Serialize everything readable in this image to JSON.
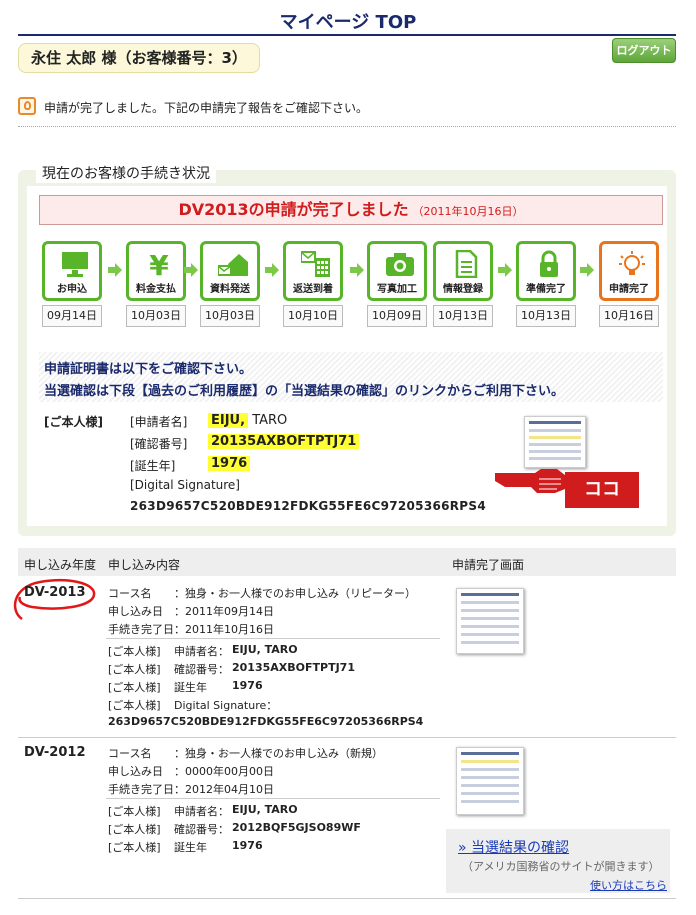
{
  "header": {
    "title": "マイページ TOP",
    "customer": "永住 太郎 様（お客様番号：3）",
    "logout": "ログアウト"
  },
  "message": "申請が完了しました。下記の申請完了報告をご確認下さい。",
  "status": {
    "title": "現在のお客様の手続き状況",
    "banner_main": "DV2013の申請が完了しました",
    "banner_date": "（2011年10月16日）",
    "steps": [
      {
        "label": "お申込",
        "date": "09月14日",
        "icon": "monitor-icon"
      },
      {
        "label": "料金支払",
        "date": "10月03日",
        "icon": "yen-icon"
      },
      {
        "label": "資料発送",
        "date": "10月03日",
        "icon": "house-mail-icon"
      },
      {
        "label": "返送到着",
        "date": "10月10日",
        "icon": "mail-keypad-icon"
      },
      {
        "label": "写真加工",
        "date": "10月09日",
        "icon": "camera-icon"
      },
      {
        "label": "情報登録",
        "date": "10月13日",
        "icon": "document-icon"
      },
      {
        "label": "準備完了",
        "date": "10月13日",
        "icon": "lock-icon"
      },
      {
        "label": "申請完了",
        "date": "10月16日",
        "icon": "lightbulb-icon"
      }
    ],
    "note1": "申請証明書は以下をご確認下さい。",
    "note2": "当選確認は下段【過去のご利用履歴】の「当選結果の確認」のリンクからご利用下さい。",
    "owner_label": "[ご本人様]",
    "name_label": "[申請者名]",
    "name_hl": "EIJU,",
    "name_rest": " TARO",
    "confirm_label": "[確認番号]",
    "confirm": "20135AXBOFTPTJ71",
    "birth_label": "[誕生年]",
    "birth": "1976",
    "sig_label": "[Digital Signature]",
    "sig": "263D9657C520BDE912FDKG55FE6C97205366RPS4",
    "koko": "ココ"
  },
  "history": {
    "headers": [
      "申し込み年度",
      "申し込み内容",
      "申請完了画面"
    ],
    "rows": [
      {
        "year": "DV-2013",
        "course_label": "コース名",
        "course": "：独身・お一人様でのお申し込み（リピーター）",
        "apply_label": "申し込み日",
        "apply": "：2011年09月14日",
        "done_label": "手続き完了日",
        "done": "：2011年10月16日",
        "owner": "[ご本人様]",
        "name_label": "申請者名：",
        "name": "EIJU, TARO",
        "confirm_label": "確認番号：",
        "confirm": "20135AXBOFTPTJ71",
        "birth_label": "誕生年",
        "birth": "1976",
        "sig_label": "Digital Signature：",
        "sig": "263D9657C520BDE912FDKG55FE6C97205366RPS4"
      },
      {
        "year": "DV-2012",
        "course_label": "コース名",
        "course": "：独身・お一人様でのお申し込み（新規）",
        "apply_label": "申し込み日",
        "apply": "：0000年00月00日",
        "done_label": "手続き完了日",
        "done": "：2012年04月10日",
        "owner": "[ご本人様]",
        "name_label": "申請者名：",
        "name": "EIJU, TARO",
        "confirm_label": "確認番号：",
        "confirm": "2012BQF5GJSO89WF",
        "birth_label": "誕生年",
        "birth": "1976",
        "result_link": "» 当選結果の確認",
        "result_note": "（アメリカ国務省のサイトが開きます）",
        "howto": "使い方はこちら"
      }
    ]
  },
  "colors": {
    "navy": "#1a2a6c",
    "green": "#58b52a",
    "orange": "#e8741d",
    "red": "#d01c1c",
    "highlight": "#ffff33"
  }
}
